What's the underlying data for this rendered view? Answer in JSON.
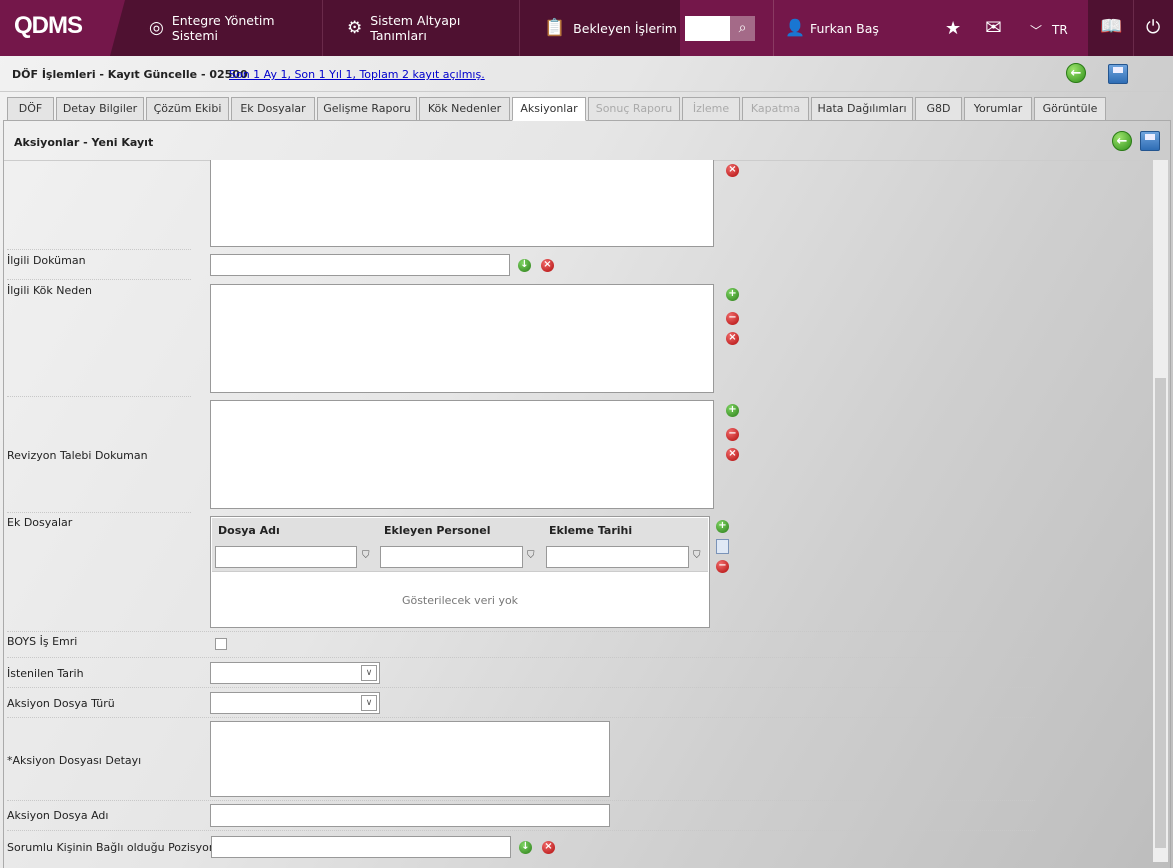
{
  "header": {
    "logo": "QDMS",
    "nav": [
      {
        "label": "Entegre Yönetim Sistemi",
        "icon": "q-icon"
      },
      {
        "label": "Sistem Altyapı Tanımları",
        "icon": "gear-icon"
      },
      {
        "label": "Bekleyen İşlerim",
        "icon": "clipboard-icon"
      }
    ],
    "user": "Furkan Baş",
    "language": "TR",
    "search_value": ""
  },
  "titlebar": {
    "title": "DÖF İşlemleri - Kayıt Güncelle - 02500",
    "link": "Son 1 Ay 1, Son 1 Yıl 1, Toplam 2 kayıt açılmış."
  },
  "tabs": [
    {
      "label": "DÖF"
    },
    {
      "label": "Detay Bilgiler"
    },
    {
      "label": "Çözüm Ekibi"
    },
    {
      "label": "Ek Dosyalar"
    },
    {
      "label": "Gelişme Raporu"
    },
    {
      "label": "Kök Nedenler"
    },
    {
      "label": "Aksiyonlar"
    },
    {
      "label": "Sonuç Raporu"
    },
    {
      "label": "İzleme"
    },
    {
      "label": "Kapatma"
    },
    {
      "label": "Hata Dağılımları"
    },
    {
      "label": "G8D"
    },
    {
      "label": "Yorumlar"
    },
    {
      "label": "Görüntüle"
    }
  ],
  "panel": {
    "title": "Aksiyonlar - Yeni Kayıt"
  },
  "form": {
    "ilgili_dokuman": "İlgili Doküman",
    "ilgili_kok_neden": "İlgili Kök Neden",
    "revizyon": "Revizyon Talebi Dokuman",
    "ek_dosyalar": "Ek Dosyalar",
    "grid": {
      "columns": [
        "Dosya Adı",
        "Ekleyen Personel",
        "Ekleme Tarihi"
      ],
      "empty": "Gösterilecek veri yok"
    },
    "boys": "BOYS İş Emri",
    "istenilen_tarih": "İstenilen Tarih",
    "dosya_turu": "Aksiyon Dosya Türü",
    "dosya_detayi": "*Aksiyon Dosyası Detayı",
    "dosya_adi": "Aksiyon Dosya Adı",
    "pozisyon": "Sorumlu Kişinin Bağlı olduğu Pozisyon"
  }
}
